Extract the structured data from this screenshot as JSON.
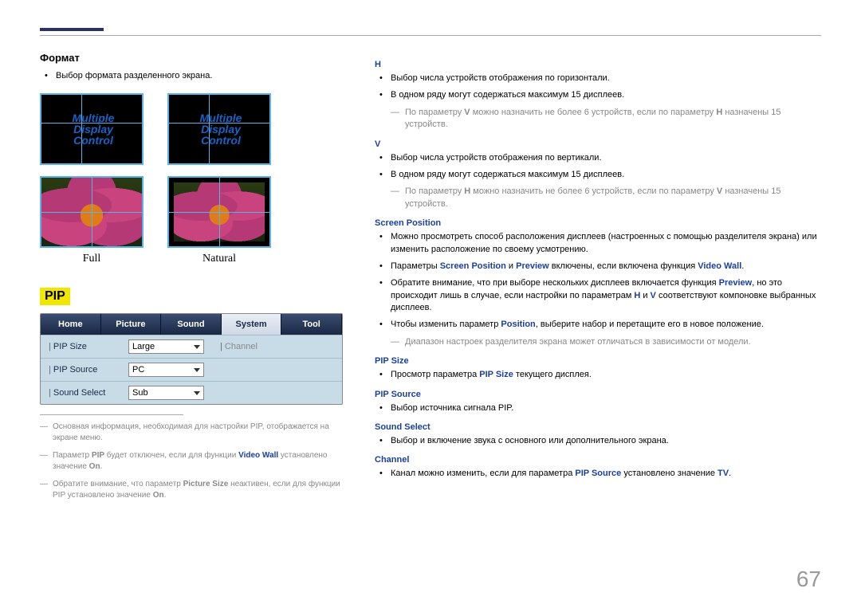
{
  "page_number": "67",
  "left": {
    "format": {
      "title": "Формат",
      "bullet": "Выбор формата разделенного экрана.",
      "mdc_text": [
        "Multiple",
        "Display",
        "Control"
      ],
      "label_full": "Full",
      "label_natural": "Natural"
    },
    "pip": {
      "badge": "PIP",
      "tabs": [
        "Home",
        "Picture",
        "Sound",
        "System",
        "Tool"
      ],
      "rows": {
        "size_label": "PIP Size",
        "size_val": "Large",
        "source_label": "PIP Source",
        "source_val": "PC",
        "sound_label": "Sound Select",
        "sound_val": "Sub",
        "disabled_field": "Channel"
      },
      "notes": [
        {
          "pre": "Основная информация, необходимая для настройки PIP, отображается на экране меню."
        },
        {
          "pre": "Параметр ",
          "b": "PIP",
          "mid": " будет отключен, если для функции ",
          "b2": "Video Wall",
          "mid2": " установлено значение ",
          "b3": "On",
          "post": "."
        },
        {
          "pre": "Обратите внимание, что параметр ",
          "b": "Picture Size",
          "mid": " неактивен, если для функции PIP установлено значение ",
          "b3": "On",
          "post": "."
        }
      ]
    }
  },
  "right": {
    "h": {
      "head": "H",
      "b1": "Выбор числа устройств отображения по горизонтали.",
      "b2": "В одном ряду могут содержаться максимум 15 дисплеев.",
      "sub_pre": "По параметру ",
      "sub_b1": "V",
      "sub_mid1": " можно назначить не более 6 устройств, если по параметру ",
      "sub_b2": "H",
      "sub_post": " назначены 15 устройств."
    },
    "v": {
      "head": "V",
      "b1": "Выбор числа устройств отображения по вертикали.",
      "b2": "В одном ряду могут содержаться максимум 15 дисплеев.",
      "sub_pre": "По параметру ",
      "sub_b1": "H",
      "sub_mid1": " можно назначить не более 6 устройств, если по параметру ",
      "sub_b2": "V",
      "sub_post": " назначены 15 устройств."
    },
    "sp": {
      "head": "Screen Position",
      "b1": "Можно просмотреть способ расположения дисплеев (настроенных с помощью разделителя экрана) или изменить расположение по своему усмотрению.",
      "b2_pre": "Параметры ",
      "b2_a": "Screen Position",
      "b2_mid1": " и ",
      "b2_b": "Preview",
      "b2_mid2": " включены, если включена функция ",
      "b2_c": "Video Wall",
      "b2_post": ".",
      "b3_pre": "Обратите внимание, что при выборе нескольких дисплеев включается функция ",
      "b3_a": "Preview",
      "b3_mid1": ", но это происходит лишь в случае, если настройки по параметрам ",
      "b3_b": "H",
      "b3_mid2": " и ",
      "b3_c": "V",
      "b3_post": " соответствуют компоновке выбранных дисплеев.",
      "b4_pre": "Чтобы изменить параметр ",
      "b4_a": "Position",
      "b4_post": ", выберите набор и перетащите его в новое положение.",
      "sub": "Диапазон настроек разделителя экрана может отличаться в зависимости от модели."
    },
    "psize": {
      "head": "PIP Size",
      "b_pre": "Просмотр параметра ",
      "b_a": "PIP Size",
      "b_post": " текущего дисплея."
    },
    "psource": {
      "head": "PIP Source",
      "b": "Выбор источника сигнала PIP."
    },
    "ss": {
      "head": "Sound Select",
      "b": "Выбор и включение звука с основного или дополнительного экрана."
    },
    "ch": {
      "head": "Channel",
      "b_pre": "Канал можно изменить, если для параметра ",
      "b_a": "PIP Source",
      "b_mid": " установлено значение ",
      "b_b": "TV",
      "b_post": "."
    }
  }
}
